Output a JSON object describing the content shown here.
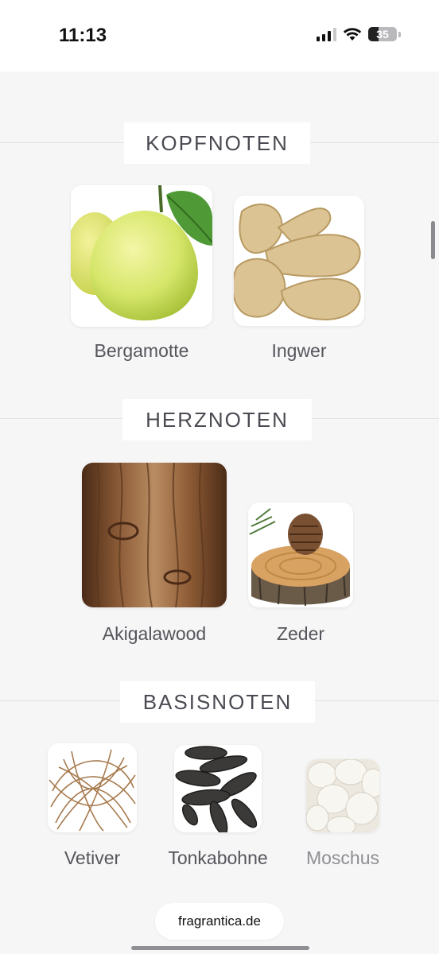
{
  "status_bar": {
    "time": "11:13",
    "battery_level": "35",
    "battery_percent": 35,
    "icons": [
      "cellular-signal-icon",
      "wifi-icon",
      "battery-icon"
    ]
  },
  "sections": {
    "top": {
      "title": "KOPFNOTEN",
      "notes": [
        {
          "label": "Bergamotte",
          "icon": "bergamot-image"
        },
        {
          "label": "Ingwer",
          "icon": "ginger-image"
        }
      ]
    },
    "heart": {
      "title": "HERZNOTEN",
      "notes": [
        {
          "label": "Akigalawood",
          "icon": "wood-texture-image"
        },
        {
          "label": "Zeder",
          "icon": "cedar-stump-image"
        }
      ]
    },
    "base": {
      "title": "BASISNOTEN",
      "notes": [
        {
          "label": "Vetiver",
          "icon": "vetiver-roots-image"
        },
        {
          "label": "Tonkabohne",
          "icon": "tonka-beans-image"
        },
        {
          "label": "Moschus",
          "icon": "musk-image"
        }
      ]
    }
  },
  "footer": {
    "site": "fragrantica.de"
  },
  "colors": {
    "background": "#f6f6f7",
    "heading_text": "#4a4a52",
    "label_text": "#55555c"
  }
}
